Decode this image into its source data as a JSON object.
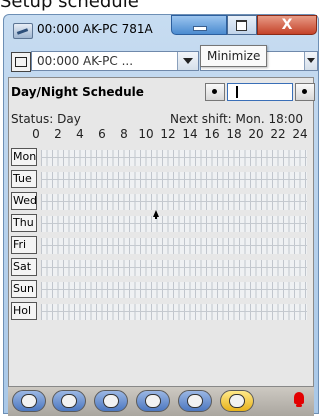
{
  "page_caption": "Setup schedule",
  "window": {
    "title": "00:000 AK-PC 781A",
    "caption_buttons": {
      "close": "X"
    },
    "tooltip": "Minimize"
  },
  "toolbar": {
    "site_selector_value": "00:000 AK-PC ..."
  },
  "panel": {
    "title": "Day/Night Schedule",
    "status": "Status: Day",
    "next_shift": "Next shift: Mon. 18:00"
  },
  "hours": [
    "0",
    "2",
    "4",
    "6",
    "8",
    "10",
    "12",
    "14",
    "16",
    "18",
    "20",
    "22",
    "24"
  ],
  "days": [
    "Mon",
    "Tue",
    "Wed",
    "Thu",
    "Fri",
    "Sat",
    "Sun",
    "Hol"
  ],
  "bottom_toolbar": {
    "items": [
      {
        "name": "alarm-tab",
        "label": "",
        "active": false
      },
      {
        "name": "grid-tab",
        "label": "",
        "active": false
      },
      {
        "name": "refresh-tab",
        "label": "",
        "active": false
      },
      {
        "name": "graph-tab",
        "label": "",
        "active": false
      },
      {
        "name": "bell-tab",
        "label": "",
        "active": false
      },
      {
        "name": "wrench-tab",
        "label": "",
        "active": true
      }
    ]
  },
  "colors": {
    "titlebar": "#b9d1ea",
    "minimize_hover": "#4b8bd0",
    "close": "#c4432a",
    "track": "#bfc5cc",
    "active_tab": "#e8b21b",
    "alarm": "#e30000"
  }
}
